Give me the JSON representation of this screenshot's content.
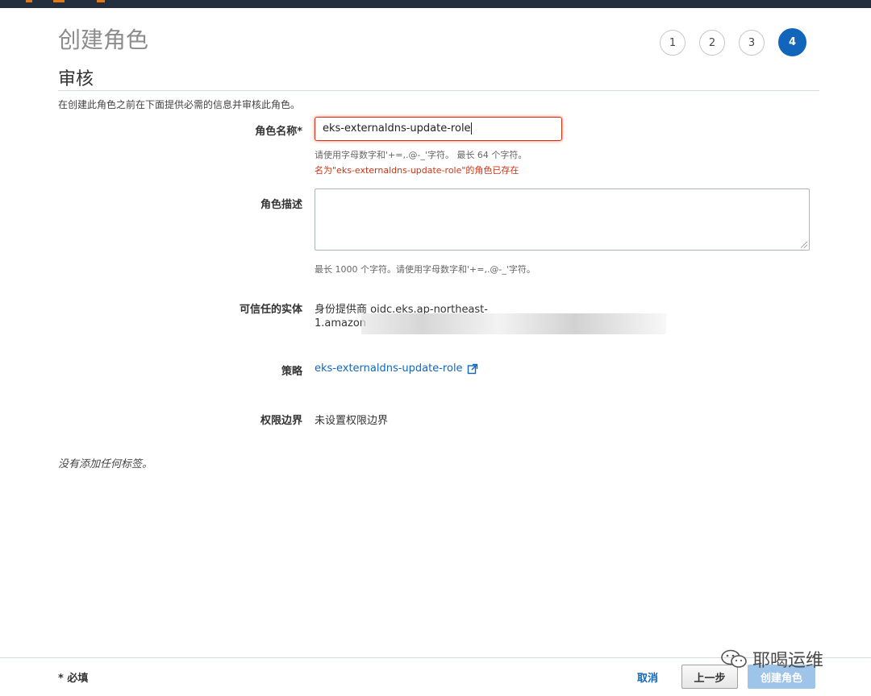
{
  "header": {
    "page_title": "创建角色",
    "section_title": "审核"
  },
  "steps": [
    {
      "label": "1",
      "active": false
    },
    {
      "label": "2",
      "active": false
    },
    {
      "label": "3",
      "active": false
    },
    {
      "label": "4",
      "active": true
    }
  ],
  "intro_text": "在创建此角色之前在下面提供必需的信息并审核此角色。",
  "form": {
    "role_name": {
      "label": "角色名称*",
      "value": "eks-externaldns-update-role",
      "hint": "请使用字母数字和'+=,.@-_'字符。 最长 64 个字符。",
      "error": "名为\"eks-externaldns-update-role\"的角色已存在"
    },
    "role_description": {
      "label": "角色描述",
      "value": "",
      "hint": "最长 1000 个字符。请使用字母数字和'+=,.@-_'字符。"
    },
    "trusted_entity": {
      "label": "可信任的实体",
      "line1": "身份提供商 oidc.eks.ap-northeast-",
      "line2": "1.amazon"
    },
    "policy": {
      "label": "策略",
      "link_text": "eks-externaldns-update-role"
    },
    "permissions_boundary": {
      "label": "权限边界",
      "value": "未设置权限边界"
    }
  },
  "no_tags_text": "没有添加任何标签。",
  "footer": {
    "required_note": "* 必填",
    "cancel_label": "取消",
    "previous_label": "上一步",
    "create_label": "创建角色"
  },
  "watermark": {
    "text": "耶喝运维",
    "icon": "wechat-icon"
  },
  "colors": {
    "accent": "#1166bb",
    "error": "#d13212",
    "topbar": "#232f3e",
    "disabled_button": "#9fc4ea"
  }
}
